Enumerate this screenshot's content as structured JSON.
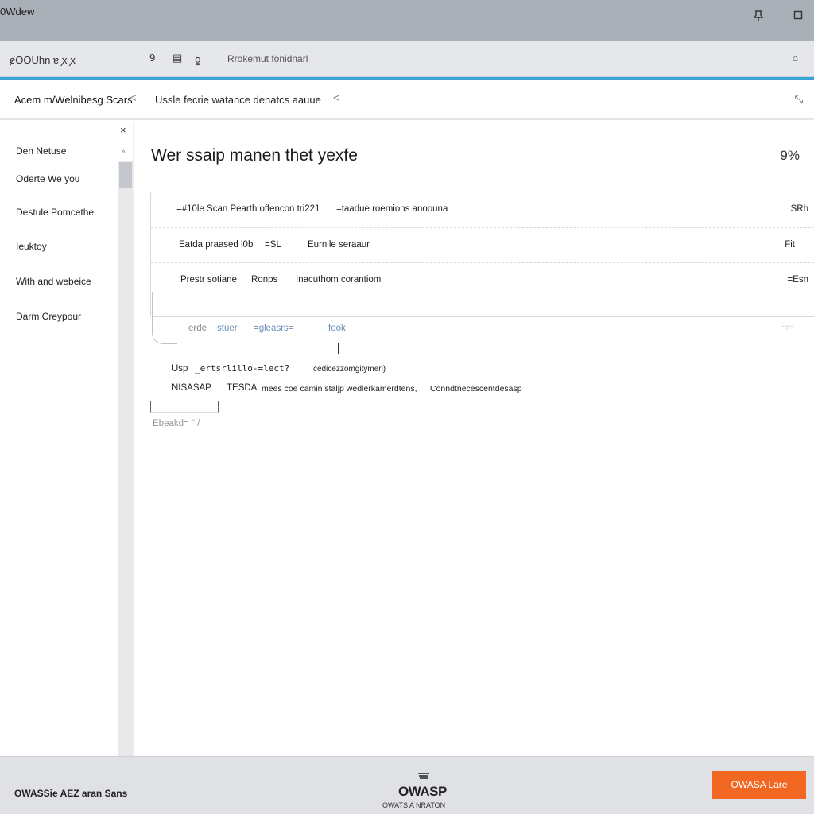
{
  "window": {
    "title": "0Wdew"
  },
  "titlebar": {
    "pin_icon": "pin-icon",
    "restore_icon": "window-restore-icon"
  },
  "toolbar": {
    "address": "ɇOOUhn ɐ ꭗ ꭗ",
    "icon_1": "9",
    "icon_2": "▤",
    "icon_3": "ꬶ",
    "placeholder": "Rrokemut fonidnarl",
    "lock_glyph": "⌂"
  },
  "breadcrumb": {
    "first": "Acem m/Welnibesg Scars",
    "second": "Ussle fecrie watance denatcs aauue",
    "chevron": "<",
    "expand_glyph": "⤡"
  },
  "sidebar": {
    "close_glyph": "×",
    "up_glyph": "^",
    "items": [
      {
        "label": "Den Netuse"
      },
      {
        "label": "Oderte We you"
      },
      {
        "label": "Destule Pomcethe"
      },
      {
        "label": "Ieuktoy"
      },
      {
        "label": "With and webeice"
      },
      {
        "label": "Darm Creypour"
      }
    ]
  },
  "main": {
    "title": "Wer ssaip manen thet yexfe",
    "meta": "9%",
    "rows": [
      {
        "c1": "=#10le Scan Pearth offencon tri221",
        "c2": "=taadue roemions anoouna",
        "right": "SRh"
      },
      {
        "c1": "Eatda praased l0b",
        "c2": "=SL",
        "c3": "Eurnile seraaur",
        "right": "Fit"
      },
      {
        "c1": "Prestr sotiane",
        "c2": "Ronps",
        "c3": "Inacuthom corantiom",
        "right": "=Esn"
      }
    ],
    "subrow": {
      "a": "erde",
      "b": "stuer",
      "c": "=gleasrs=",
      "d": "fook",
      "right": "=r="
    },
    "line1": {
      "label": "Usp",
      "code": "_ertsrlillo-=lect?",
      "tail": "cedicezzomgitymerl)"
    },
    "line2": {
      "label": "NISASAP",
      "tag": "TESDA",
      "text": "mees coe camin staljp wedlerkamerdtens,",
      "link": "Conndtnecescentdesasp"
    },
    "line3": {
      "text": "Ebeakd=  \"  /"
    }
  },
  "footer": {
    "brand": "OWASSie AEZ aran Sans",
    "logo": "OWASP",
    "logo_sub": "OWATS A NRATON",
    "cta": "OWASA Lare",
    "accent": "#f26722"
  }
}
